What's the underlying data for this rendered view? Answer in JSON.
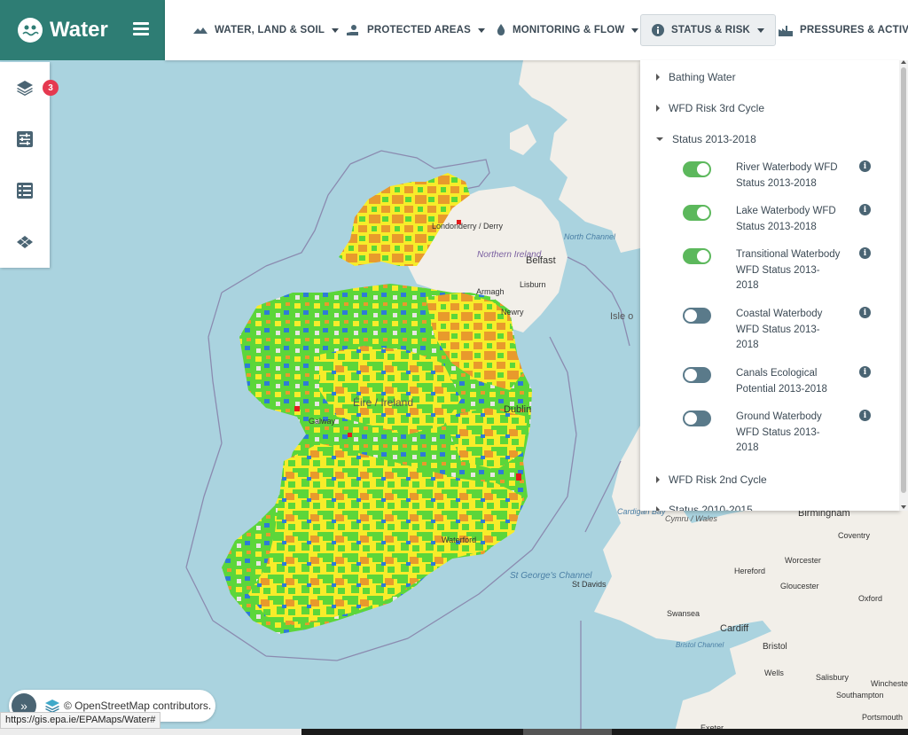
{
  "app": {
    "title": "Water"
  },
  "nav": [
    {
      "label": "WATER, LAND & SOIL"
    },
    {
      "label": "PROTECTED AREAS"
    },
    {
      "label": "MONITORING & FLOW"
    },
    {
      "label": "STATUS & RISK"
    },
    {
      "label": "PRESSURES & ACTIVITIES"
    }
  ],
  "toolbar": {
    "layer_count": "3"
  },
  "panel": {
    "sections": [
      {
        "label": "Bathing Water"
      },
      {
        "label": "WFD Risk 3rd Cycle"
      },
      {
        "label": "Status 2013-2018"
      },
      {
        "label": "WFD Risk 2nd Cycle"
      },
      {
        "label": "Status 2010-2015"
      }
    ],
    "layers": [
      {
        "label": "River Waterbody WFD Status 2013-2018",
        "enabled": true
      },
      {
        "label": "Lake Waterbody WFD Status 2013-2018",
        "enabled": true
      },
      {
        "label": "Transitional Waterbody WFD Status 2013-2018",
        "enabled": true
      },
      {
        "label": "Coastal Waterbody WFD Status 2013-2018",
        "enabled": false
      },
      {
        "label": "Canals Ecological Potential 2013-2018",
        "enabled": false
      },
      {
        "label": "Ground Waterbody WFD Status 2013-2018",
        "enabled": false
      }
    ],
    "info_glyph": "i"
  },
  "map_labels": {
    "derry": "Londonderry / Derry",
    "northern_ireland": "Northern Ireland",
    "belfast": "Belfast",
    "lisburn": "Lisburn",
    "armagh": "Armagh",
    "newry": "Newry",
    "north_channel": "North Channel",
    "isle": "Isle o",
    "eire": "Éire / Ireland",
    "dublin": "Dublin",
    "galway": "Galway",
    "waterford": "Waterford",
    "st_georges": "St George's Channel",
    "st_davids": "St Davids",
    "cymru": "Cymru / Wales",
    "cardigan": "Cardigan Bay",
    "birmingham": "Birmingham",
    "coventry": "Coventry",
    "worcester": "Worcester",
    "hereford": "Hereford",
    "gloucester": "Gloucester",
    "oxford": "Oxford",
    "swansea": "Swansea",
    "cardiff": "Cardiff",
    "bristol_channel": "Bristol Channel",
    "bristol": "Bristol",
    "wells": "Wells",
    "salisbury": "Salisbury",
    "winchester": "Winchester",
    "southampton": "Southampton",
    "portsmouth": "Portsmouth",
    "exeter": "Exeter"
  },
  "attribution": {
    "text": "© OpenStreetMap contributors.",
    "expand_glyph": "»"
  },
  "status_url": "https://gis.epa.ie/EPAMaps/Water#",
  "colors": {
    "brand": "#2e7d74",
    "sea": "#aad3df",
    "land": "#f2efe9",
    "high": "#2e7bd6",
    "good": "#5cd63a",
    "moderate": "#f7ec2a",
    "poor": "#e89a2c",
    "bad": "#e41a1c",
    "toggle_on": "#5cb85c",
    "toggle_off": "#5a7a8a"
  }
}
